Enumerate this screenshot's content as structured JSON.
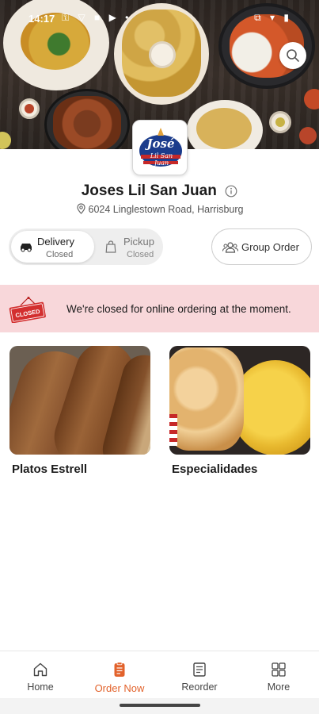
{
  "status_bar": {
    "time": "14:17",
    "left_icons": "⚿ ▽ ■ ▶ •",
    "right_icons": "⧉ ▾ ▮"
  },
  "restaurant": {
    "name": "Joses Lil San Juan",
    "address": "6024 Linglestown Road, Harrisburg",
    "logo_text": "José",
    "logo_sub": "Lil San Juan"
  },
  "order_mode": {
    "delivery": {
      "label": "Delivery",
      "status": "Closed"
    },
    "pickup": {
      "label": "Pickup",
      "status": "Closed"
    },
    "selected": "delivery"
  },
  "group_order": {
    "label": "Group Order"
  },
  "banner": {
    "sign_text": "CLOSED",
    "message": "We're closed for online ordering at the moment."
  },
  "categories": [
    {
      "title": "Platos Estrell"
    },
    {
      "title": "Especialidades"
    }
  ],
  "nav": {
    "items": [
      {
        "label": "Home",
        "icon": "home-icon"
      },
      {
        "label": "Order Now",
        "icon": "order-icon"
      },
      {
        "label": "Reorder",
        "icon": "receipt-icon"
      },
      {
        "label": "More",
        "icon": "grid-icon"
      }
    ],
    "active": "Order Now"
  },
  "colors": {
    "accent": "#e2622b",
    "banner_bg": "#f8d7da",
    "closed_sign": "#d32f2f"
  }
}
